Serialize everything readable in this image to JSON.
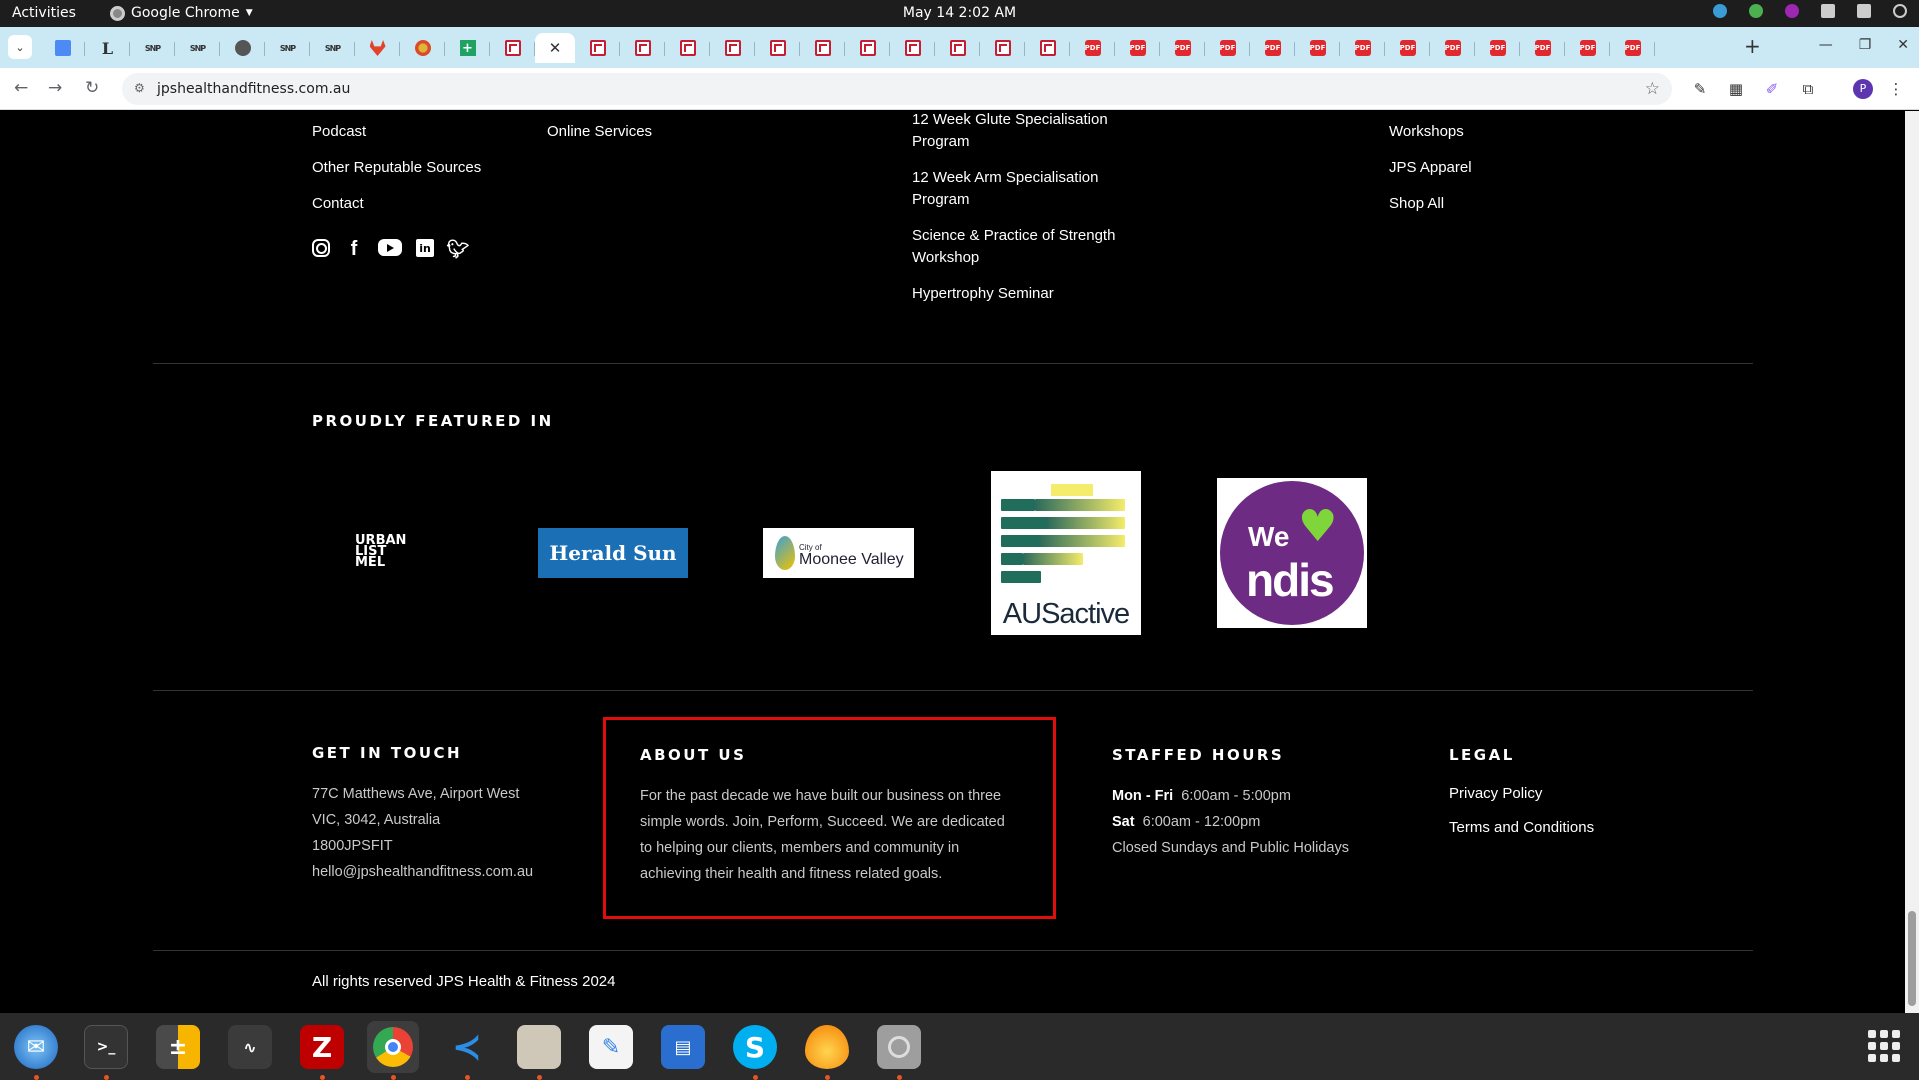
{
  "topbar": {
    "activities": "Activities",
    "app_name": "Google Chrome",
    "clock": "May 14  2:02 AM"
  },
  "browser": {
    "url": "jpshealthandfitness.com.au",
    "profile_initial": "P",
    "tabs": [
      {
        "icon": "docs-icon"
      },
      {
        "icon": "l-icon"
      },
      {
        "icon": "snp-icon"
      },
      {
        "icon": "snp-icon"
      },
      {
        "icon": "globe-icon"
      },
      {
        "icon": "snp-icon"
      },
      {
        "icon": "snp-icon"
      },
      {
        "icon": "gitlab-icon"
      },
      {
        "icon": "firefox-icon"
      },
      {
        "icon": "sheets-icon"
      },
      {
        "icon": "rb-icon"
      },
      {
        "icon": "active-close"
      },
      {
        "icon": "rb-icon"
      },
      {
        "icon": "rb-icon"
      },
      {
        "icon": "rb-icon"
      },
      {
        "icon": "rb-icon"
      },
      {
        "icon": "rb-icon"
      },
      {
        "icon": "rb-icon"
      },
      {
        "icon": "rb-icon"
      },
      {
        "icon": "rb-icon"
      },
      {
        "icon": "rb-icon"
      },
      {
        "icon": "rb-icon"
      },
      {
        "icon": "rb-icon"
      },
      {
        "icon": "pdf-icon"
      },
      {
        "icon": "pdf-icon"
      },
      {
        "icon": "pdf-icon"
      },
      {
        "icon": "pdf-icon"
      },
      {
        "icon": "pdf-icon"
      },
      {
        "icon": "pdf-icon"
      },
      {
        "icon": "pdf-icon"
      },
      {
        "icon": "pdf-icon"
      },
      {
        "icon": "pdf-icon"
      },
      {
        "icon": "pdf-icon"
      },
      {
        "icon": "pdf-icon"
      },
      {
        "icon": "pdf-icon"
      },
      {
        "icon": "pdf-icon"
      }
    ]
  },
  "footer": {
    "col1_links": [
      "Podcast",
      "Other Reputable Sources",
      "Contact"
    ],
    "col2_links": [
      "Online Services"
    ],
    "col3_links": [
      "12 Week Glute Specialisation Program",
      "12 Week Arm Specialisation Program",
      "Science & Practice of Strength Workshop",
      "Hypertrophy Seminar"
    ],
    "col4_links": [
      "Workshops",
      "JPS Apparel",
      "Shop All"
    ],
    "social": [
      "instagram-icon",
      "facebook-icon",
      "youtube-icon",
      "linkedin-icon",
      "twitter-icon"
    ],
    "featured_heading": "PROUDLY FEATURED IN",
    "logos": {
      "urban": "URBAN LIST MEL",
      "herald": "Herald Sun",
      "moonee_small": "City of",
      "moonee_big": "Moonee Valley",
      "ausactive": "AUSactive",
      "ndis_we": "We",
      "ndis_word": "ndis"
    },
    "get_in_touch": {
      "heading": "GET IN TOUCH",
      "lines": [
        "77C Matthews Ave, Airport West",
        "VIC, 3042, Australia",
        "1800JPSFIT",
        "hello@jpshealthandfitness.com.au"
      ]
    },
    "about": {
      "heading": "ABOUT US",
      "text": "For the past decade we have built our business on three simple words. Join, Perform, Succeed. We are dedicated to helping our clients, members and community in achieving their health and fitness related goals."
    },
    "hours": {
      "heading": "STAFFED HOURS",
      "line1_day": "Mon - Fri",
      "line1_time": "6:00am - 5:00pm",
      "line2_day": "Sat",
      "line2_time": "6:00am - 12:00pm",
      "line3": "Closed Sundays and Public Holidays"
    },
    "legal": {
      "heading": "LEGAL",
      "links": [
        "Privacy Policy",
        "Terms and Conditions"
      ]
    },
    "copyright": "All rights reserved JPS Health & Fitness 2024"
  },
  "dock": [
    "thunderbird-icon",
    "terminal-icon",
    "calculator-icon",
    "system-monitor-icon",
    "filezilla-icon",
    "chrome-icon",
    "vscode-icon",
    "files-icon",
    "text-editor-icon",
    "document-viewer-icon",
    "skype-icon",
    "blaze-icon",
    "disk-icon"
  ],
  "colors": {
    "highlight_border": "#e00d0d",
    "tabstrip": "#cbe8f5",
    "page_bg": "#000000"
  }
}
